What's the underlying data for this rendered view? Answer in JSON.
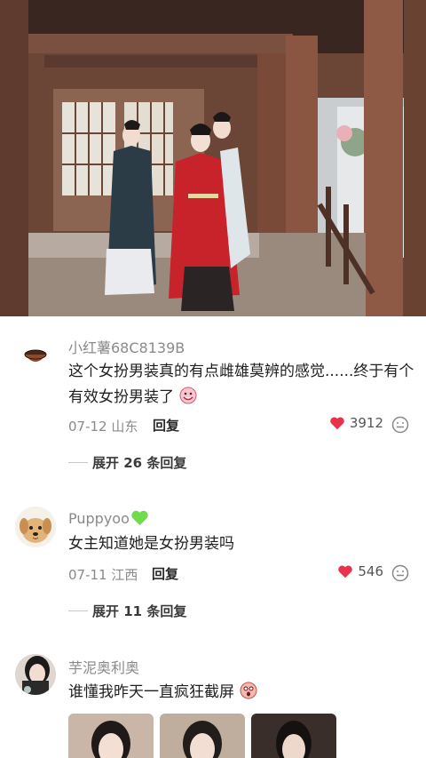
{
  "comments": [
    {
      "username": "小红薯68C8139B",
      "text": "这个女扮男装真的有点雌雄莫辨的感觉......终于有个有效女扮男装了",
      "date": "07-12 山东",
      "reply_label": "回复",
      "likes": "3912",
      "expand_label": "展开 26 条回复",
      "avatar_icon": "bowl-avatar",
      "trailing_emoji": "crying-laughing-emoji"
    },
    {
      "username": "Puppyoo",
      "username_emoji": "green-heart-emoji",
      "text": "女主知道她是女扮男装吗",
      "date": "07-11 江西",
      "reply_label": "回复",
      "likes": "546",
      "expand_label": "展开 11 条回复",
      "avatar_icon": "dog-avatar"
    },
    {
      "username": "芋泥奥利奥",
      "text": "谁懂我昨天一直疯狂截屏",
      "avatar_icon": "girl-avatar",
      "trailing_emoji": "shocked-emoji",
      "thumbnail_count": 3
    }
  ],
  "colors": {
    "like_heart": "#e8314a",
    "meta_gray": "#8a8a8a",
    "green_heart": "#6fdc4c"
  },
  "icons": {
    "reaction": "smiley-icon",
    "like": "heart-icon"
  }
}
